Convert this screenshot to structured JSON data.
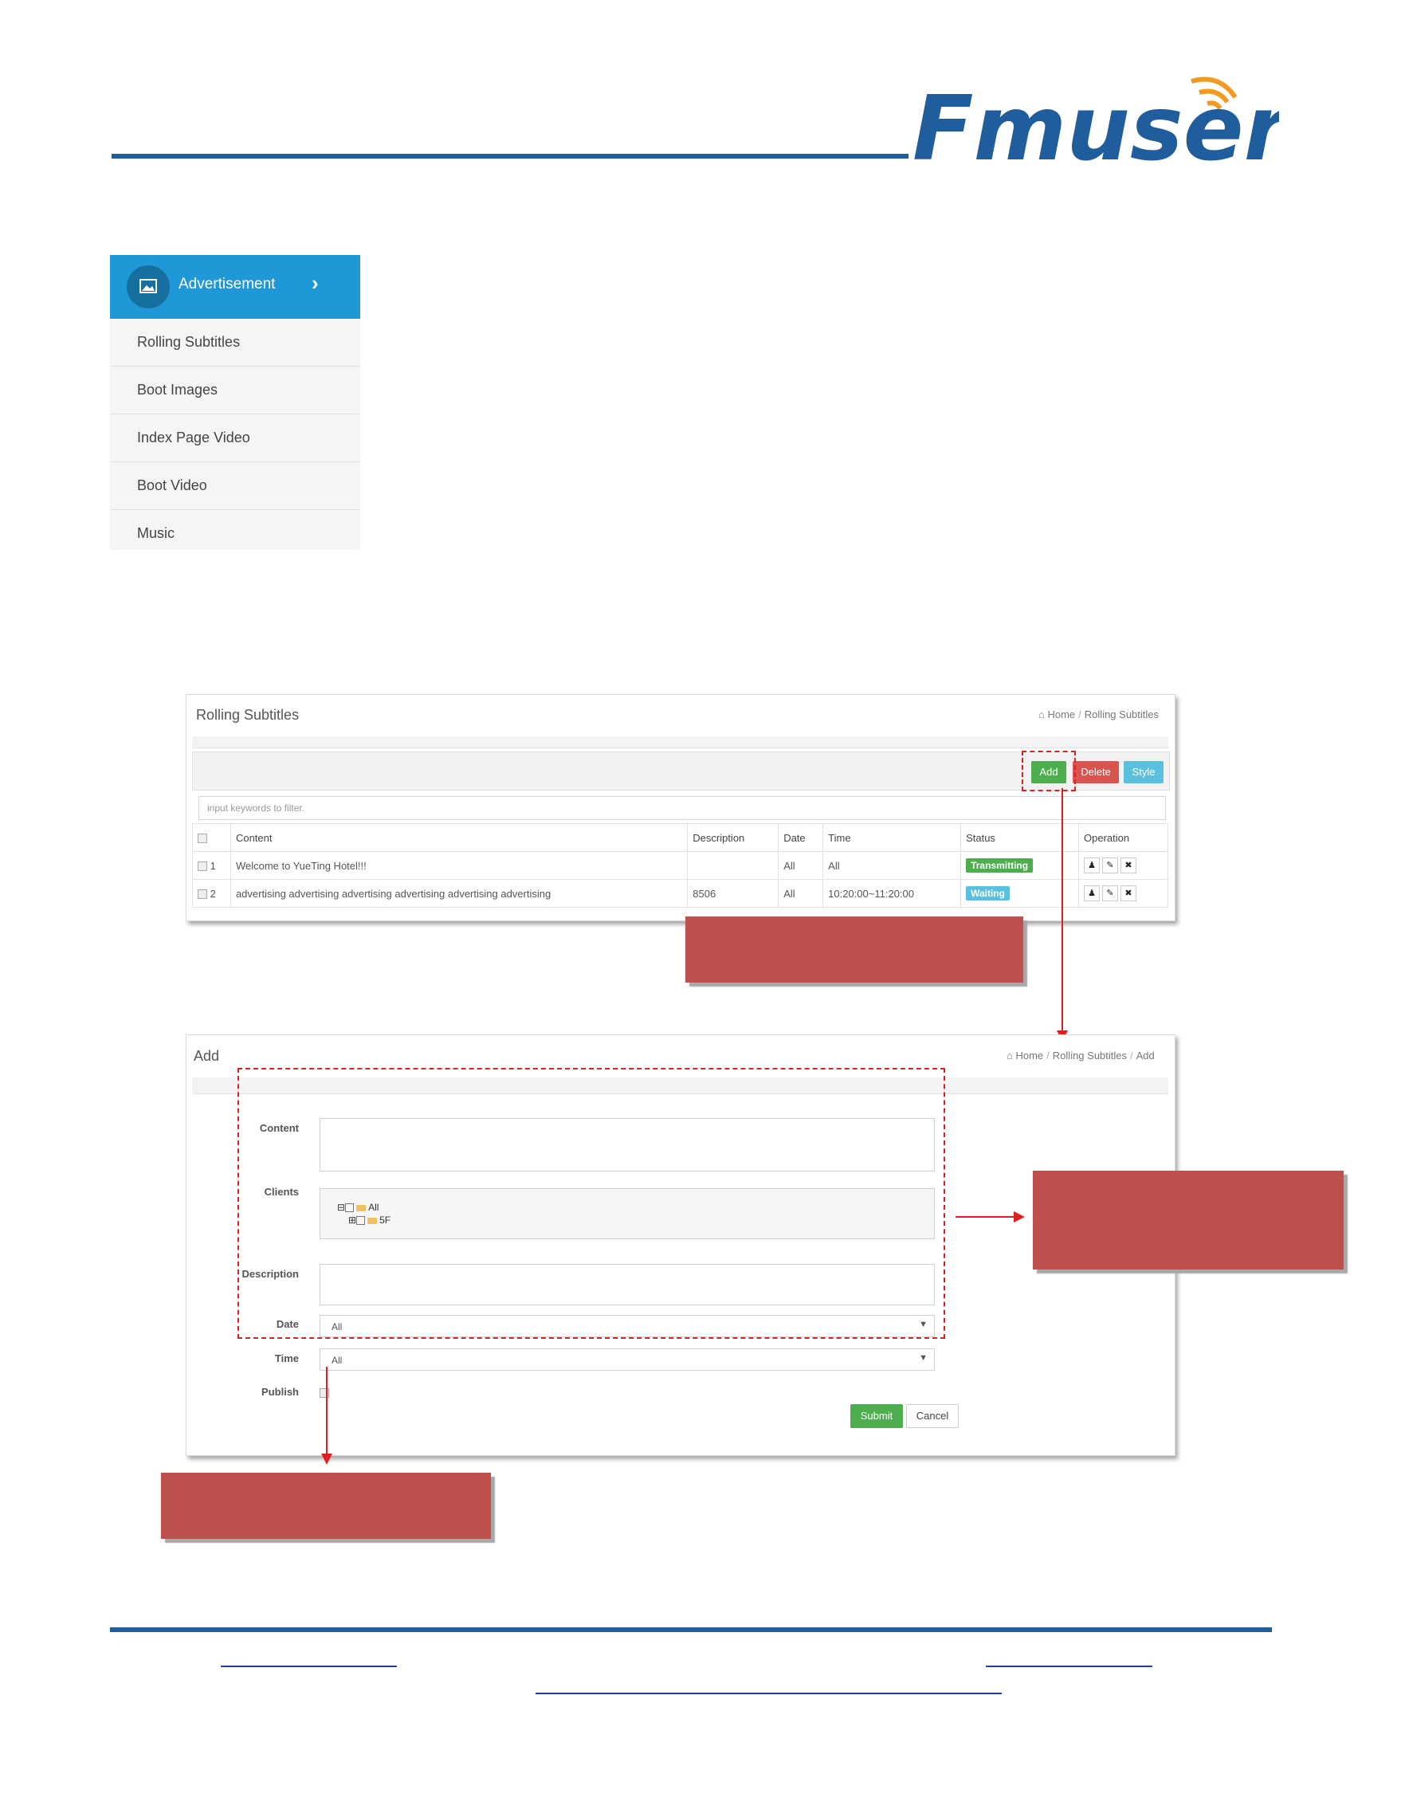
{
  "brand": {
    "logo_text": "Fmuser"
  },
  "colors": {
    "brand_blue": "#1f5d9c",
    "active_menu": "#1e98d6",
    "callout": "#c0504d",
    "annotation": "#e02020",
    "success": "#4cae4c",
    "danger": "#d9534f",
    "info": "#5bc0de"
  },
  "sidebar": {
    "active": {
      "icon": "image-icon",
      "label": "Advertisement",
      "chevron_icon": "chevron-right-icon"
    },
    "items": [
      {
        "label": "Rolling Subtitles"
      },
      {
        "label": "Boot Images"
      },
      {
        "label": "Index Page Video"
      },
      {
        "label": "Boot Video"
      },
      {
        "label": "Music"
      }
    ]
  },
  "list_screen": {
    "title": "Rolling Subtitles",
    "breadcrumb": {
      "home_icon": "home-icon",
      "home": "Home",
      "current": "Rolling Subtitles"
    },
    "buttons": {
      "add": "Add",
      "delete": "Delete",
      "style": "Style"
    },
    "filter_placeholder": "input keywords to filter.",
    "columns": [
      "Content",
      "Description",
      "Date",
      "Time",
      "Status",
      "Operation"
    ],
    "rows": [
      {
        "index": "1",
        "content": "Welcome to YueTing Hotel!!!",
        "description": "",
        "date": "All",
        "time": "All",
        "status": "Transmitting",
        "status_color": "#4cae4c"
      },
      {
        "index": "2",
        "content": "advertising advertising advertising advertising advertising advertising",
        "description": "8506",
        "date": "All",
        "time": "10:20:00~11:20:00",
        "status": "Waiting",
        "status_color": "#5bc0de"
      }
    ],
    "operation_icons": [
      "user-icon",
      "pencil-icon",
      "close-icon"
    ]
  },
  "add_screen": {
    "title": "Add",
    "breadcrumb": {
      "home_icon": "home-icon",
      "home": "Home",
      "parent": "Rolling Subtitles",
      "current": "Add"
    },
    "labels": {
      "content": "Content",
      "clients": "Clients",
      "description": "Description",
      "date": "Date",
      "time": "Time",
      "publish": "Publish"
    },
    "tree": {
      "root": "All",
      "child": "5F"
    },
    "date_value": "All",
    "time_value": "All",
    "submit": "Submit",
    "cancel": "Cancel"
  }
}
